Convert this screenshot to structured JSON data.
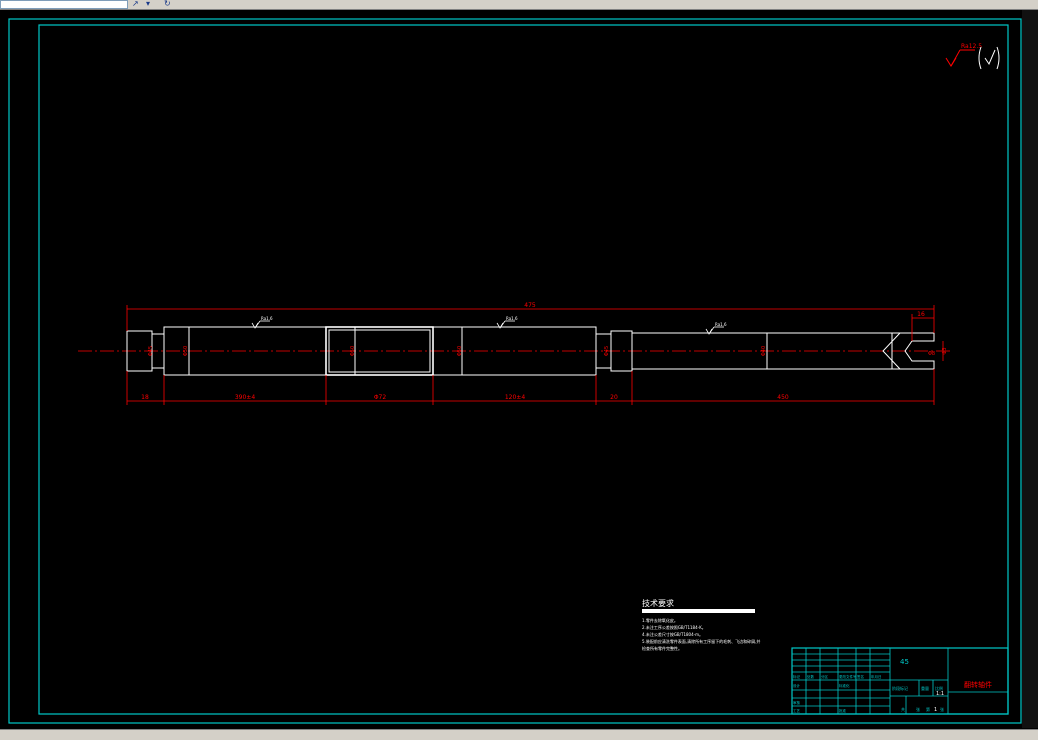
{
  "toolbar": {
    "icon_pick": "arrow-icon",
    "icon_cycle": "refresh-icon"
  },
  "drawing": {
    "overall_length": "475",
    "segment_dims": [
      "18",
      "390±4",
      "Φ72",
      "120±4",
      "20",
      "450"
    ],
    "diameter_labels": [
      "Φ45",
      "Φ50",
      "Φ50",
      "Φ50",
      "Φ45",
      "Φ40",
      "Φ3"
    ],
    "roughness_marks": [
      "Ra1.6",
      "Ra1.6",
      "Ra1.6"
    ],
    "roughness_general": "Ra12.5",
    "notch_dim_top": "16",
    "notch_dim_side": "Φ8",
    "tech_title": "技术要求",
    "tech_lines": [
      "1.零件去除氧化皮。",
      "2.未注工序公差按照GB/T1184-K。",
      "4.未注公差尺寸按GB/T1804-m。",
      "5.装配前应清洗零件表面,清除所有工序留下的毛刺、飞边和碎屑,并",
      "  检查所有零件完整性。"
    ]
  },
  "title_block": {
    "material": "45",
    "part_name": "翻转轴件",
    "scale": "1:1",
    "sheet": "1",
    "headers": [
      "标记",
      "处数",
      "分区",
      "更改文件号",
      "签名",
      "年月日"
    ],
    "row_labels": [
      "设计",
      "审核",
      "工艺"
    ],
    "row_notes": [
      "标准化",
      "批准"
    ],
    "stage_label": "阶段标记",
    "weight_label": "重量",
    "scale_label": "比例",
    "sheet_labels": [
      "共",
      "张",
      "第",
      "张"
    ]
  },
  "colors": {
    "border": "#00c8c8",
    "dimension": "#ff0000",
    "object": "#ffffff",
    "grid": "#00c8c8"
  }
}
